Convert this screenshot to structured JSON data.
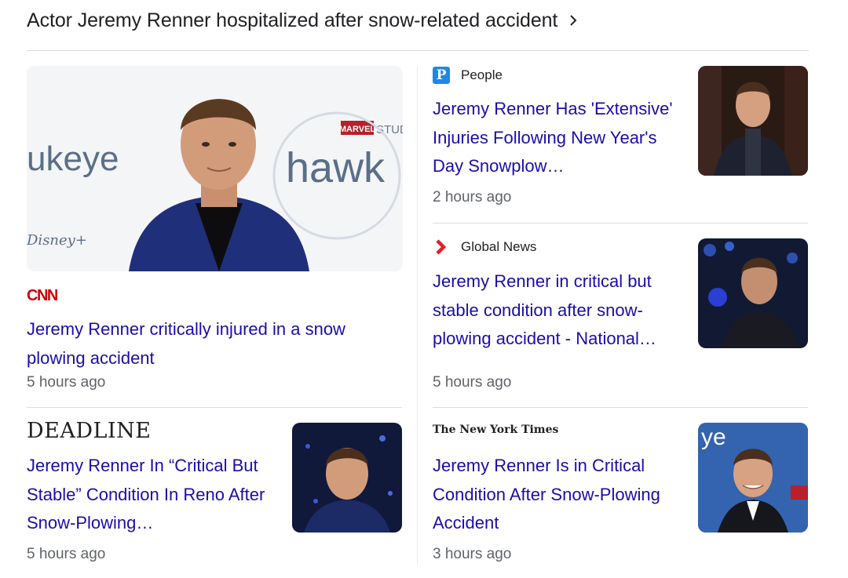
{
  "header": {
    "title": "Actor Jeremy Renner hospitalized after snow-related accident"
  },
  "main_story": {
    "source": "CNN",
    "title": "Jeremy Renner critically injured in a snow plowing accident",
    "time": "5 hours ago",
    "image_text": {
      "left_word": "ukeye",
      "right_word": "hawk",
      "disney": "Disney+",
      "marvel": "MARVEL",
      "studios": "STUD"
    }
  },
  "stories": [
    {
      "source": "People",
      "logo_letter": "P",
      "title": "Jeremy Renner Has 'Extensive' Injuries Following New Year's Day Snowplow…",
      "time": "2 hours ago"
    },
    {
      "source": "Global News",
      "title": "Jeremy Renner in critical but stable condition after snow-plowing accident - National…",
      "time": "5 hours ago"
    },
    {
      "source": "DEADLINE",
      "title": "Jeremy Renner In “Critical But Stable” Condition In Reno After Snow-Plowing…",
      "time": "5 hours ago"
    },
    {
      "source": "The New York Times",
      "title": "Jeremy Renner Is in Critical Condition After Snow-Plowing Accident",
      "time": "3 hours ago",
      "image_text": "ye"
    }
  ],
  "colors": {
    "link": "#1a0dab",
    "cnn": "#cc0000",
    "people": "#1e88e5",
    "global_news": "#e4202e",
    "divider": "#dadce0"
  }
}
